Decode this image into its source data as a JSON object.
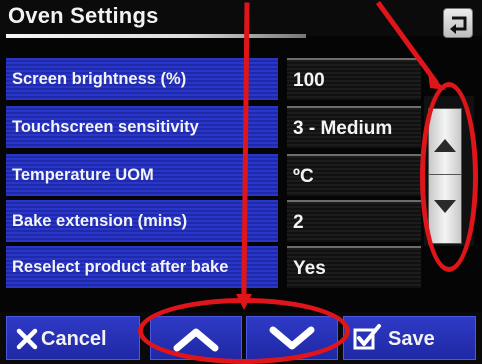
{
  "header": {
    "title": "Oven Settings",
    "back_icon": "return-arrow-icon"
  },
  "settings": [
    {
      "label": "Screen brightness (%)",
      "value": "100"
    },
    {
      "label": "Touchscreen sensitivity",
      "value": "3 - Medium"
    },
    {
      "label": "Temperature UOM",
      "value": "ºC"
    },
    {
      "label": "Bake extension (mins)",
      "value": "2"
    },
    {
      "label": "Reselect product after bake",
      "value": "Yes"
    }
  ],
  "scroll": {
    "up_icon": "triangle-up-icon",
    "down_icon": "triangle-down-icon"
  },
  "footer": {
    "cancel_label": "Cancel",
    "cancel_icon": "x-icon",
    "prev_icon": "chevron-up-icon",
    "next_icon": "chevron-down-icon",
    "save_label": "Save",
    "save_icon": "checkbox-icon"
  },
  "colors": {
    "label_blue": "#2a35c9",
    "button_blue": "#2f3ac6",
    "annotation_red": "#e0151a"
  }
}
